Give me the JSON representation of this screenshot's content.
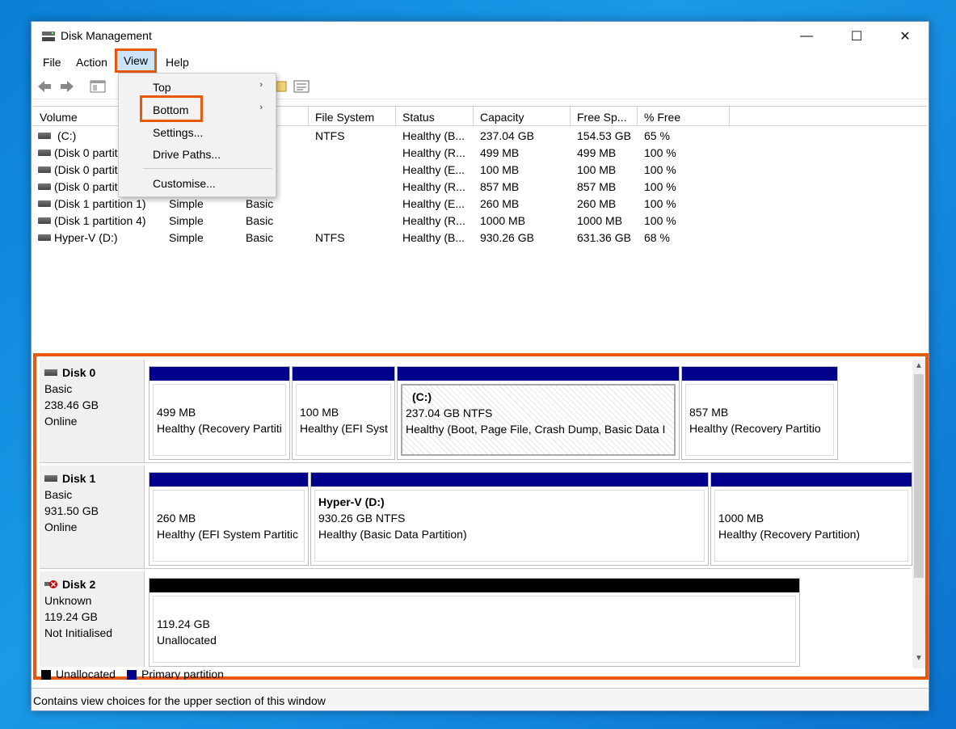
{
  "window": {
    "title": "Disk Management",
    "controls": {
      "minimize": "—",
      "maximize": "☐",
      "close": "✕"
    }
  },
  "menubar": {
    "file": "File",
    "action": "Action",
    "view": "View",
    "help": "Help"
  },
  "view_menu": {
    "items": [
      {
        "label": "Top",
        "has_submenu": true
      },
      {
        "label": "Bottom",
        "has_submenu": true
      },
      {
        "label": "Settings..."
      },
      {
        "label": "Drive Paths..."
      },
      {
        "label": "Customise..."
      }
    ]
  },
  "volume_table": {
    "columns": [
      "Volume",
      "",
      "",
      "File System",
      "Status",
      "Capacity",
      "Free Sp...",
      "% Free"
    ],
    "rows": [
      {
        "volume": "(C:)",
        "layout": "",
        "type": "",
        "fs": "NTFS",
        "status": "Healthy (B...",
        "capacity": "237.04 GB",
        "free": "154.53 GB",
        "pct": "65 %"
      },
      {
        "volume": "(Disk 0 partition 1)",
        "layout": "",
        "type": "",
        "fs": "",
        "status": "Healthy (R...",
        "capacity": "499 MB",
        "free": "499 MB",
        "pct": "100 %"
      },
      {
        "volume": "(Disk 0 partition 2)",
        "layout": "",
        "type": "",
        "fs": "",
        "status": "Healthy (E...",
        "capacity": "100 MB",
        "free": "100 MB",
        "pct": "100 %"
      },
      {
        "volume": "(Disk 0 partition 5)",
        "layout": "",
        "type": "",
        "fs": "",
        "status": "Healthy (R...",
        "capacity": "857 MB",
        "free": "857 MB",
        "pct": "100 %"
      },
      {
        "volume": "(Disk 1 partition 1)",
        "layout": "Simple",
        "type": "Basic",
        "fs": "",
        "status": "Healthy (E...",
        "capacity": "260 MB",
        "free": "260 MB",
        "pct": "100 %"
      },
      {
        "volume": "(Disk 1 partition 4)",
        "layout": "Simple",
        "type": "Basic",
        "fs": "",
        "status": "Healthy (R...",
        "capacity": "1000 MB",
        "free": "1000 MB",
        "pct": "100 %"
      },
      {
        "volume": "Hyper-V (D:)",
        "layout": "Simple",
        "type": "Basic",
        "fs": "NTFS",
        "status": "Healthy (B...",
        "capacity": "930.26 GB",
        "free": "631.36 GB",
        "pct": "68 %"
      }
    ]
  },
  "disks": [
    {
      "name": "Disk 0",
      "kind": "Basic",
      "size": "238.46 GB",
      "state": "Online",
      "partitions": [
        {
          "title": "",
          "size": "499 MB",
          "status": "Healthy (Recovery Partiti"
        },
        {
          "title": "",
          "size": "100 MB",
          "status": "Healthy (EFI Syst"
        },
        {
          "title": "(C:)",
          "size": "237.04 GB NTFS",
          "status": "Healthy (Boot, Page File, Crash Dump, Basic Data I"
        },
        {
          "title": "",
          "size": "857 MB",
          "status": "Healthy (Recovery Partitio"
        }
      ]
    },
    {
      "name": "Disk 1",
      "kind": "Basic",
      "size": "931.50 GB",
      "state": "Online",
      "partitions": [
        {
          "title": "",
          "size": "260 MB",
          "status": "Healthy (EFI System Partitic"
        },
        {
          "title": "Hyper-V  (D:)",
          "size": "930.26 GB NTFS",
          "status": "Healthy (Basic Data Partition)"
        },
        {
          "title": "",
          "size": "1000 MB",
          "status": "Healthy (Recovery Partition)"
        }
      ]
    },
    {
      "name": "Disk 2",
      "kind": "Unknown",
      "size": "119.24 GB",
      "state": "Not Initialised",
      "partitions": [
        {
          "title": "",
          "size": "119.24 GB",
          "status": "Unallocated"
        }
      ]
    }
  ],
  "legend": {
    "unallocated": "Unallocated",
    "primary": "Primary partition"
  },
  "statusbar": {
    "text": "Contains view choices for the upper section of this window"
  },
  "colors": {
    "primary_partition": "#00008b",
    "unallocated": "#000000",
    "highlight": "#e8590c"
  }
}
